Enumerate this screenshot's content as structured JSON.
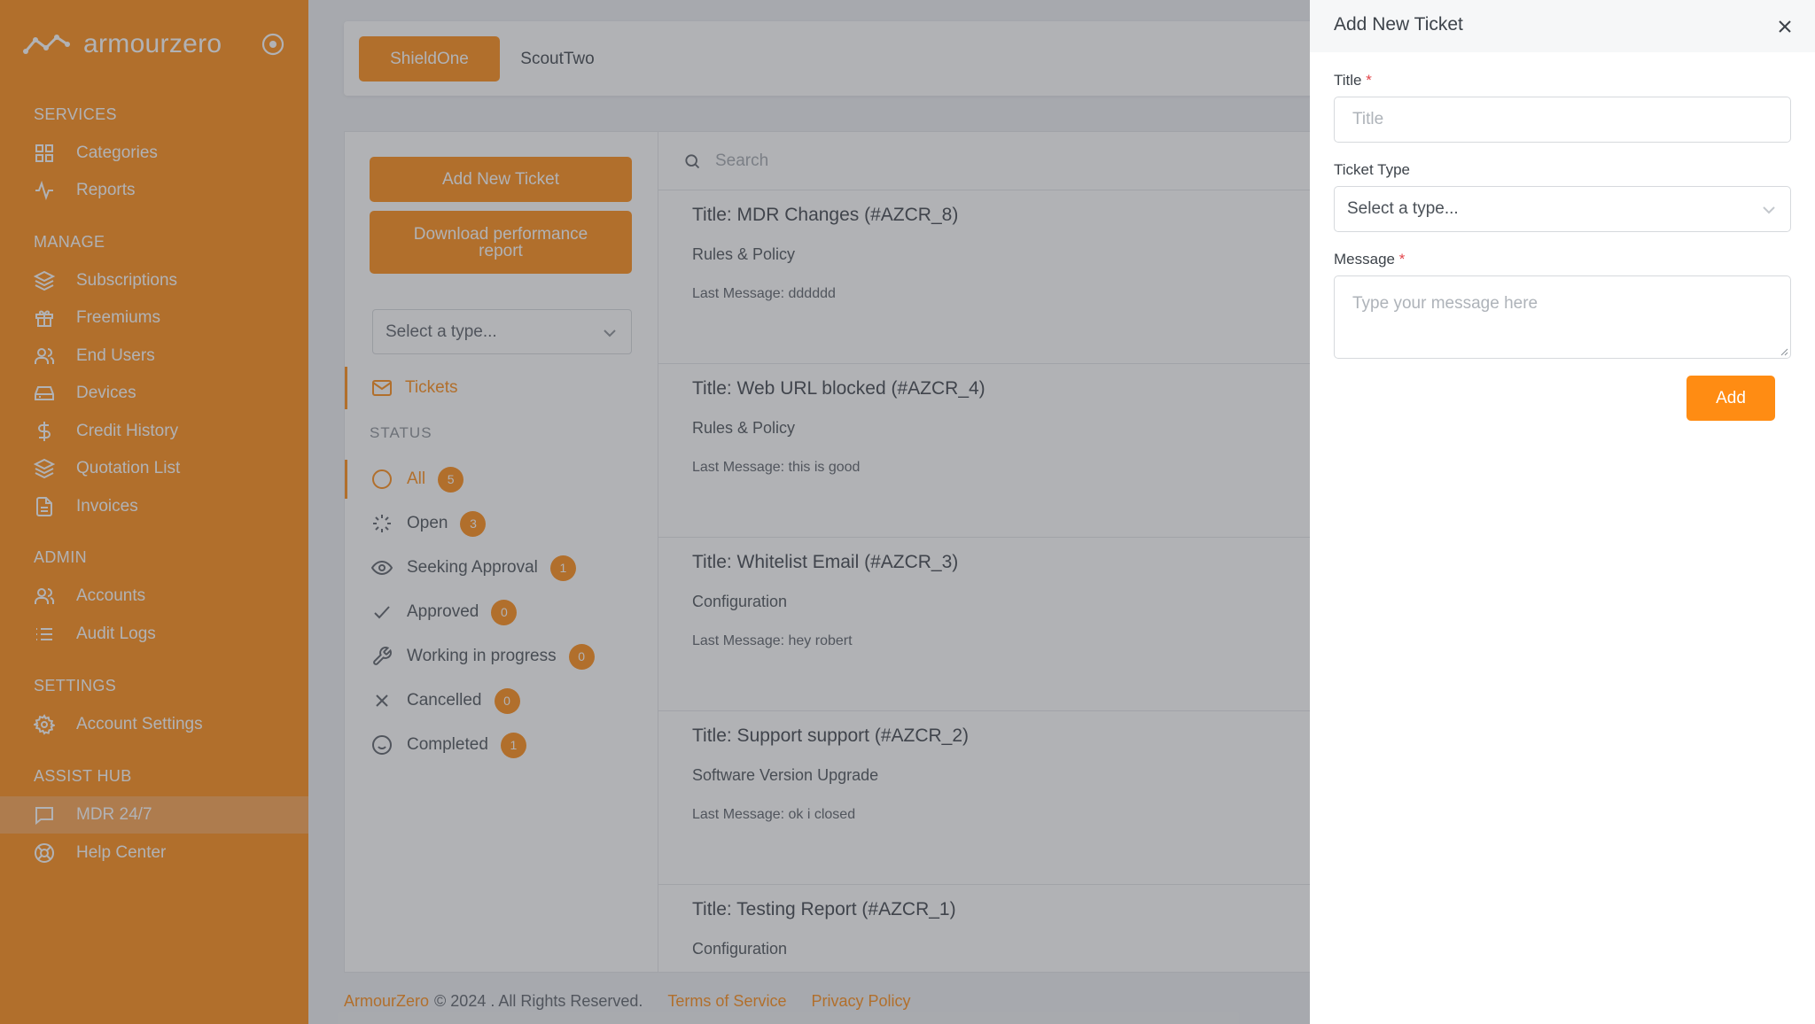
{
  "brand": {
    "name": "armourzero"
  },
  "colors": {
    "accent": "#ff8c13",
    "sidebar_active": "#faa24f",
    "required": "#e2454b"
  },
  "sidebar": {
    "sections": [
      {
        "title": "SERVICES",
        "items": [
          {
            "label": "Categories",
            "icon": "grid-icon"
          },
          {
            "label": "Reports",
            "icon": "activity-icon"
          }
        ]
      },
      {
        "title": "MANAGE",
        "items": [
          {
            "label": "Subscriptions",
            "icon": "layers-icon"
          },
          {
            "label": "Freemiums",
            "icon": "gift-icon"
          },
          {
            "label": "End Users",
            "icon": "users-icon"
          },
          {
            "label": "Devices",
            "icon": "drive-icon"
          },
          {
            "label": "Credit History",
            "icon": "dollar-icon"
          },
          {
            "label": "Quotation List",
            "icon": "layers-icon"
          },
          {
            "label": "Invoices",
            "icon": "file-icon"
          }
        ]
      },
      {
        "title": "ADMIN",
        "items": [
          {
            "label": "Accounts",
            "icon": "users-icon"
          },
          {
            "label": "Audit Logs",
            "icon": "list-icon"
          }
        ]
      },
      {
        "title": "SETTINGS",
        "items": [
          {
            "label": "Account Settings",
            "icon": "gear-icon"
          }
        ]
      },
      {
        "title": "ASSIST HUB",
        "items": [
          {
            "label": "MDR 24/7",
            "icon": "chat-icon",
            "active": true
          },
          {
            "label": "Help Center",
            "icon": "lifebuoy-icon"
          }
        ]
      }
    ]
  },
  "tabs": [
    {
      "label": "ShieldOne",
      "active": true
    },
    {
      "label": "ScoutTwo",
      "active": false
    }
  ],
  "left_panel": {
    "add_ticket_label": "Add New Ticket",
    "download_report_label": "Download performance report",
    "type_select": "Select a type...",
    "tickets_label": "Tickets",
    "status_heading": "STATUS",
    "statuses": [
      {
        "label": "All",
        "count": "5",
        "icon": "circle-icon",
        "active": true
      },
      {
        "label": "Open",
        "count": "3",
        "icon": "loader-icon"
      },
      {
        "label": "Seeking Approval",
        "count": "1",
        "icon": "eye-icon"
      },
      {
        "label": "Approved",
        "count": "0",
        "icon": "check-icon"
      },
      {
        "label": "Working in progress",
        "count": "0",
        "icon": "wrench-icon"
      },
      {
        "label": "Cancelled",
        "count": "0",
        "icon": "x-icon"
      },
      {
        "label": "Completed",
        "count": "1",
        "icon": "smile-icon"
      }
    ]
  },
  "search": {
    "placeholder": "Search"
  },
  "tickets": [
    {
      "title": "Title: MDR Changes (#AZCR_8)",
      "category": "Rules & Policy",
      "last_message": "Last Message: dddddd"
    },
    {
      "title": "Title: Web URL blocked (#AZCR_4)",
      "category": "Rules & Policy",
      "last_message": "Last Message: this is good"
    },
    {
      "title": "Title: Whitelist Email (#AZCR_3)",
      "category": "Configuration",
      "last_message": "Last Message: hey robert"
    },
    {
      "title": "Title: Support support (#AZCR_2)",
      "category": "Software Version Upgrade",
      "last_message": "Last Message: ok i closed"
    },
    {
      "title": "Title: Testing Report (#AZCR_1)",
      "category": "Configuration",
      "last_message": ""
    }
  ],
  "footer": {
    "company": "ArmourZero",
    "rights": "© 2024 . All Rights Reserved.",
    "terms": "Terms of Service",
    "privacy": "Privacy Policy"
  },
  "drawer": {
    "title": "Add New Ticket",
    "title_label": "Title",
    "title_placeholder": "Title",
    "type_label": "Ticket Type",
    "type_value": "Select a type...",
    "message_label": "Message",
    "message_placeholder": "Type your message here",
    "required_mark": "*",
    "add_label": "Add"
  }
}
